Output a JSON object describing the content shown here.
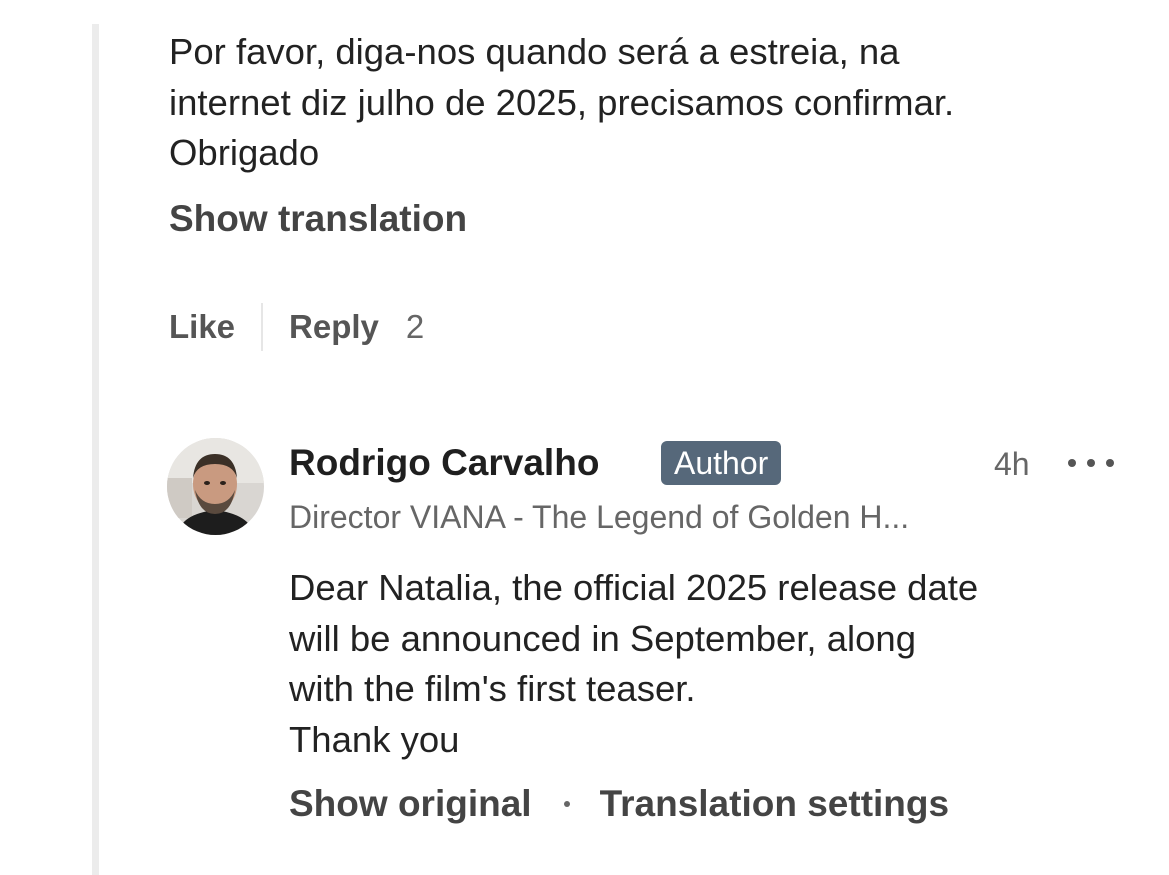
{
  "comment": {
    "text_lines": [
      "Por favor, diga-nos quando será a estreia, na",
      "internet diz julho de 2025, precisamos confirmar.",
      "Obrigado"
    ],
    "show_translation_label": "Show translation",
    "actions": {
      "like_label": "Like",
      "reply_label": "Reply",
      "reply_count": "2"
    }
  },
  "reply": {
    "author_name": "Rodrigo Carvalho",
    "badge": "Author",
    "timestamp": "4h",
    "more_icon": "ellipsis-icon",
    "headline": "Director VIANA - The Legend of Golden H...",
    "text_lines": [
      "Dear Natalia, the official 2025 release date",
      "will be announced in September, along",
      "with the film's first teaser.",
      "Thank you"
    ],
    "show_original_label": "Show original",
    "translation_settings_label": "Translation settings"
  },
  "colors": {
    "badge_bg": "#56687a",
    "thread_line": "#ececec"
  }
}
